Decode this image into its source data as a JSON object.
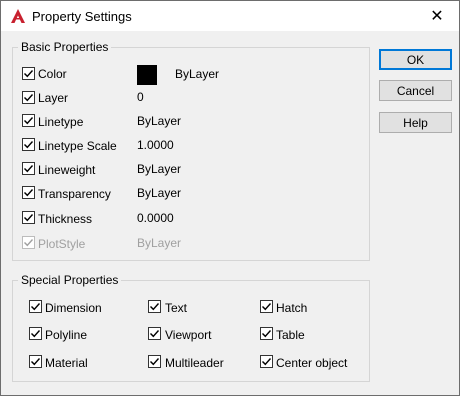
{
  "window": {
    "title": "Property Settings",
    "close_glyph": "✕",
    "accent": "#0078d7",
    "app_icon_color": "#c8202f"
  },
  "basic": {
    "label": "Basic Properties",
    "rows": [
      {
        "label": "Color",
        "value": "ByLayer",
        "checked": true,
        "enabled": true
      },
      {
        "label": "Layer",
        "value": "0",
        "checked": true,
        "enabled": true
      },
      {
        "label": "Linetype",
        "value": "ByLayer",
        "checked": true,
        "enabled": true
      },
      {
        "label": "Linetype Scale",
        "value": "1.0000",
        "checked": true,
        "enabled": true
      },
      {
        "label": "Lineweight",
        "value": "ByLayer",
        "checked": true,
        "enabled": true
      },
      {
        "label": "Transparency",
        "value": "ByLayer",
        "checked": true,
        "enabled": true
      },
      {
        "label": "Thickness",
        "value": "0.0000",
        "checked": true,
        "enabled": true
      },
      {
        "label": "PlotStyle",
        "value": "ByLayer",
        "checked": true,
        "enabled": false
      }
    ]
  },
  "special": {
    "label": "Special Properties",
    "items": [
      {
        "label": "Dimension",
        "checked": true
      },
      {
        "label": "Text",
        "checked": true
      },
      {
        "label": "Hatch",
        "checked": true
      },
      {
        "label": "Polyline",
        "checked": true
      },
      {
        "label": "Viewport",
        "checked": true
      },
      {
        "label": "Table",
        "checked": true
      },
      {
        "label": "Material",
        "checked": true
      },
      {
        "label": "Multileader",
        "checked": true
      },
      {
        "label": "Center object",
        "checked": true
      }
    ]
  },
  "buttons": {
    "ok": "OK",
    "cancel": "Cancel",
    "help": "Help"
  }
}
